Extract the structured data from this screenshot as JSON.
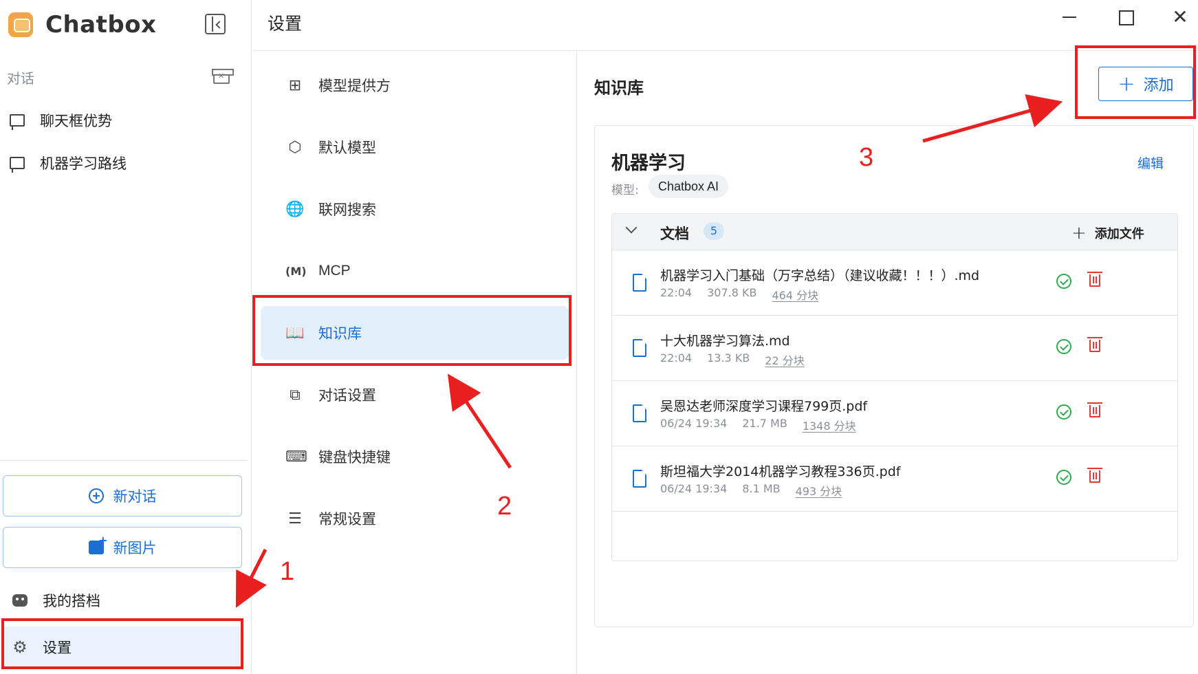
{
  "app": {
    "name": "Chatbox"
  },
  "sidebar": {
    "section_label": "对话",
    "conversations": [
      {
        "label": "聊天框优势"
      },
      {
        "label": "机器学习路线"
      }
    ],
    "new_chat_label": "新对话",
    "new_image_label": "新图片",
    "my_partner_label": "我的搭档",
    "settings_label": "设置"
  },
  "header": {
    "title": "设置"
  },
  "settings_menu": {
    "items": [
      {
        "label": "模型提供方",
        "icon": "grid-icon"
      },
      {
        "label": "默认模型",
        "icon": "cube-icon"
      },
      {
        "label": "联网搜索",
        "icon": "globe-icon"
      },
      {
        "label": "MCP",
        "icon": "mcp-icon"
      },
      {
        "label": "知识库",
        "icon": "book-icon",
        "active": true
      },
      {
        "label": "对话设置",
        "icon": "chat-settings-icon"
      },
      {
        "label": "键盘快捷键",
        "icon": "keyboard-icon"
      },
      {
        "label": "常规设置",
        "icon": "sliders-icon"
      }
    ]
  },
  "knowledge_base": {
    "title": "知识库",
    "add_label": "添加",
    "card": {
      "name": "机器学习",
      "edit_label": "编辑",
      "model_label": "模型:",
      "model_value": "Chatbox AI",
      "docs_label": "文档",
      "docs_count": "5",
      "add_file_label": "添加文件",
      "documents": [
        {
          "name": "机器学习入门基础（万字总结）（建议收藏！！！）.md",
          "time": "22:04",
          "size": "307.8 KB",
          "chunks": "464 分块"
        },
        {
          "name": "十大机器学习算法.md",
          "time": "22:04",
          "size": "13.3 KB",
          "chunks": "22 分块"
        },
        {
          "name": "吴恩达老师深度学习课程799页.pdf",
          "time": "06/24 19:34",
          "size": "21.7 MB",
          "chunks": "1348 分块"
        },
        {
          "name": "斯坦福大学2014机器学习教程336页.pdf",
          "time": "06/24 19:34",
          "size": "8.1 MB",
          "chunks": "493 分块"
        }
      ]
    }
  },
  "annotations": {
    "step1": "1",
    "step2": "2",
    "step3": "3",
    "color": "#ea1f1f"
  },
  "colors": {
    "accent": "#1b6ed6",
    "active_bg": "#e3effb",
    "success": "#2faa4d",
    "danger": "#e53935"
  }
}
